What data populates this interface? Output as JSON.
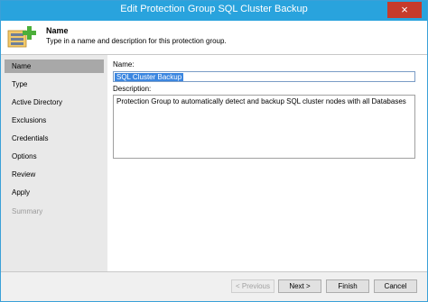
{
  "window": {
    "title": "Edit Protection Group SQL Cluster Backup",
    "close_glyph": "×"
  },
  "header": {
    "title": "Name",
    "description": "Type in a name and description for this protection group."
  },
  "sidebar": {
    "items": [
      {
        "label": "Name",
        "state": "active"
      },
      {
        "label": "Type",
        "state": "normal"
      },
      {
        "label": "Active Directory",
        "state": "normal"
      },
      {
        "label": "Exclusions",
        "state": "normal"
      },
      {
        "label": "Credentials",
        "state": "normal"
      },
      {
        "label": "Options",
        "state": "normal"
      },
      {
        "label": "Review",
        "state": "normal"
      },
      {
        "label": "Apply",
        "state": "normal"
      },
      {
        "label": "Summary",
        "state": "disabled"
      }
    ]
  },
  "form": {
    "name_label": "Name:",
    "name_value": "SQL Cluster Backup",
    "description_label": "Description:",
    "description_value": "Protection Group to automatically detect and backup SQL cluster nodes with all Databases"
  },
  "footer": {
    "previous_label": "< Previous",
    "next_label": "Next >",
    "finish_label": "Finish",
    "cancel_label": "Cancel"
  },
  "colors": {
    "titlebar": "#29a3dd",
    "close": "#c73b2b",
    "selection": "#3b86e0",
    "plus": "#4caf3a"
  }
}
